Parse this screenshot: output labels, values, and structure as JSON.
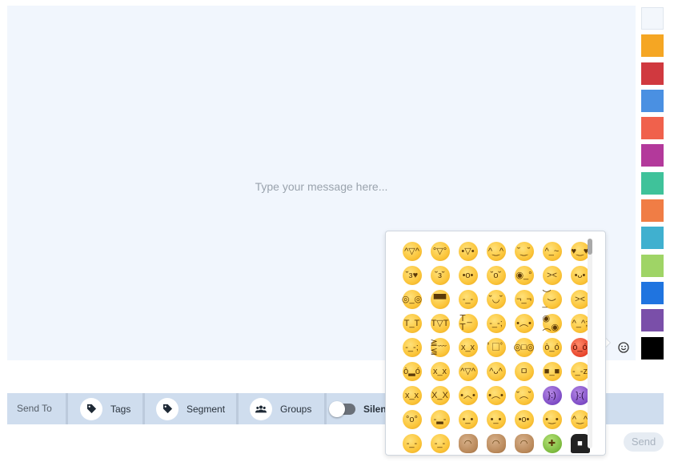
{
  "composer": {
    "placeholder": "Type your message here...",
    "emoji_icon": "smiley-icon"
  },
  "palette": {
    "colors": [
      "#f3f7fc",
      "#f5a623",
      "#d0393f",
      "#4a90e2",
      "#f0614c",
      "#b3399b",
      "#3fc29a",
      "#f07d45",
      "#40b0cf",
      "#9fd466",
      "#1f74e0",
      "#7a4fa9",
      "#000000"
    ]
  },
  "sendto": {
    "label": "Send To",
    "tags_label": "Tags",
    "tags_icon": "tag-icon",
    "segment_label": "Segment",
    "segment_icon": "tag-icon",
    "groups_label": "Groups",
    "groups_icon": "users-icon",
    "silent_label": "Silent",
    "silent_on": false
  },
  "send_label": "Send",
  "emoji_picker": {
    "glyphs": [
      "^▽^",
      "°▽°",
      "•▽•",
      "^‿^",
      "˘‿˘",
      "^_~",
      "♥‿♥",
      "˘з♥",
      "˘з˘",
      "•o•",
      "˘o˘",
      "◉_°",
      "><",
      "•ᴗ•",
      "◎_◎",
      "▀▀",
      "-_-",
      "˘◡˘",
      "¬_¬",
      "︶_︶",
      "><",
      "T_T",
      "T▽T",
      "Ｔ_Ｔ",
      "-_-;",
      "•︵•",
      "◉︵◉",
      "^_^;",
      "-_-;",
      "≧﹏≦",
      "x_x",
      "ﾟ□ﾟ",
      "◎□◎",
      "ò_ó",
      "ò_ó",
      "ò▂ó",
      "x_x",
      "^▽^",
      "^ᴗ^",
      "ㅁ",
      "■_■",
      "-_-z",
      "x_x",
      "X_X",
      "•︿•",
      "•︵•",
      "˘︵˘",
      "}:)",
      "}:(",
      "°o°",
      "-▂-",
      "•_•",
      "•_•",
      "•o•",
      "•‿•",
      "^‿^",
      "-_-",
      "-_-",
      "◠",
      "◠",
      "◠",
      "✚",
      "■"
    ],
    "variants": [
      "",
      "",
      "",
      "",
      "",
      "",
      "",
      "",
      "",
      "",
      "",
      "",
      "",
      "",
      "",
      "",
      "",
      "",
      "",
      "",
      "",
      "",
      "",
      "",
      "",
      "",
      "",
      "",
      "",
      "",
      "",
      "",
      "",
      "",
      "red",
      "",
      "",
      "",
      "",
      "",
      "",
      "",
      "",
      "",
      "",
      "",
      "",
      "purple",
      "purple",
      "",
      "",
      "",
      "",
      "",
      "",
      "",
      "",
      "",
      "person",
      "person",
      "person",
      "green",
      "dark"
    ]
  }
}
